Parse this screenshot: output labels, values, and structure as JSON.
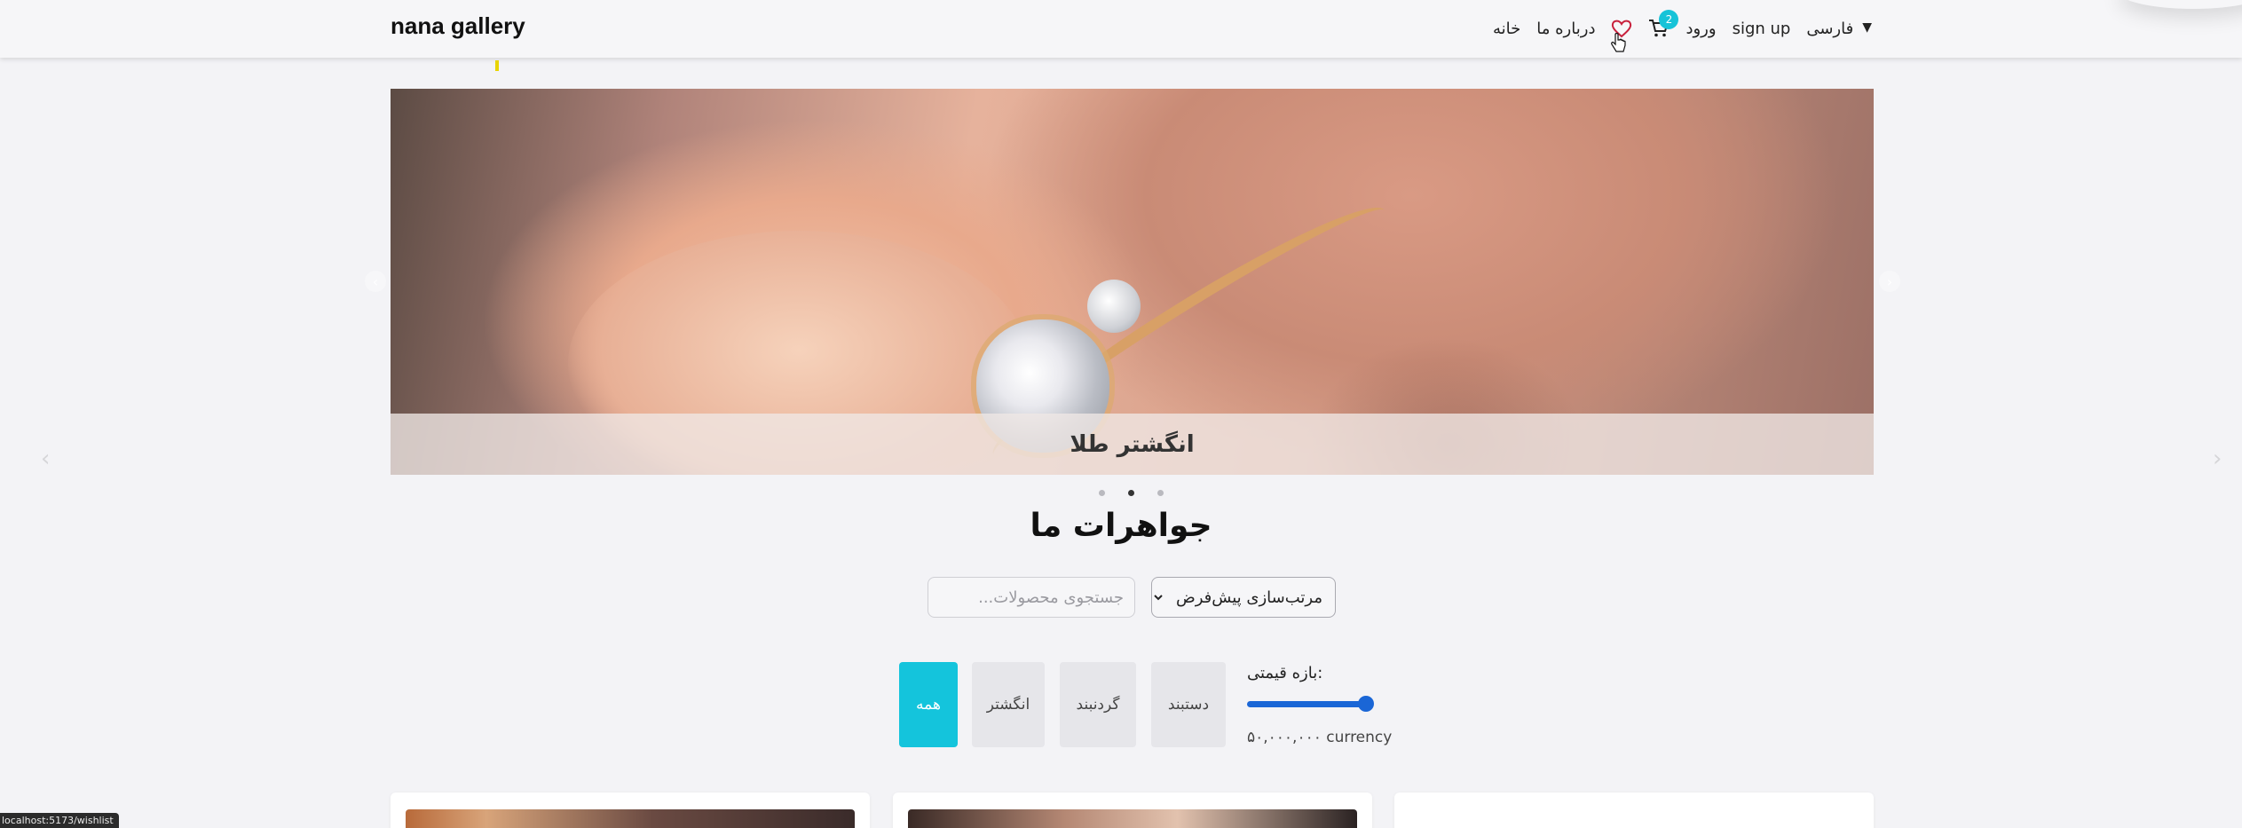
{
  "navbar": {
    "brand": "nana gallery",
    "home": "خانه",
    "about": "درباره ما",
    "cart_count": "2",
    "login": "ورود",
    "signup": "sign up",
    "language": "فارسی"
  },
  "carousel": {
    "caption": "انگشتر طلا",
    "dots_count": 3,
    "active_dot": 1
  },
  "section": {
    "title": "جواهرات ما"
  },
  "filters": {
    "search_placeholder": "جستجوی محصولات...",
    "sort_selected": "مرتب‌سازی پیش‌فرض",
    "price_label": "بازه قیمتی:",
    "price_value": "۵۰,۰۰۰,۰۰۰ currency",
    "price_fraction": 1.0,
    "categories": [
      {
        "label": "همه",
        "active": true
      },
      {
        "label": "انگشتر",
        "active": false
      },
      {
        "label": "گردنبند",
        "active": false
      },
      {
        "label": "دستبند",
        "active": false
      }
    ]
  },
  "status_bar": {
    "url": "localhost:5173/wishlist"
  },
  "colors": {
    "accent": "#14c4dc",
    "heart": "#c8203c",
    "range": "#1a66d6"
  }
}
